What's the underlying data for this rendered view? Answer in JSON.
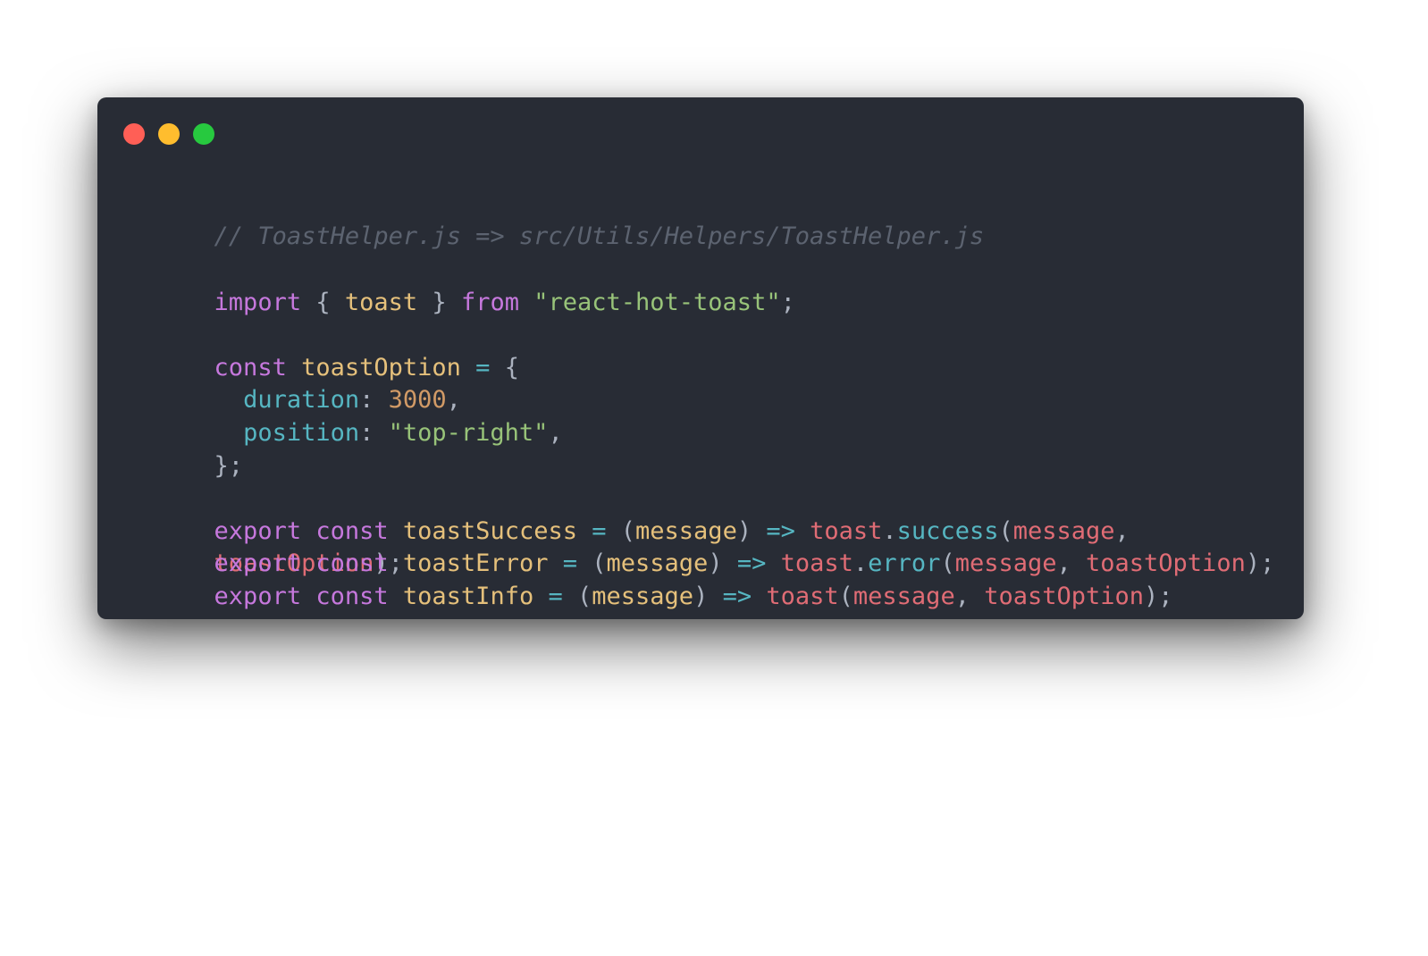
{
  "window": {
    "traffic_lights": [
      {
        "name": "close",
        "color": "#ff5f56"
      },
      {
        "name": "minimize",
        "color": "#ffbd2e"
      },
      {
        "name": "maximize",
        "color": "#27c93f"
      }
    ]
  },
  "code": {
    "comment": "// ToastHelper.js => src/Utils/Helpers/ToastHelper.js",
    "import_line": {
      "kw_import": "import",
      "open_brace": " { ",
      "ident": "toast",
      "close_brace": " } ",
      "kw_from": "from",
      "space": " ",
      "module": "\"react-hot-toast\"",
      "semi": ";"
    },
    "const_line": {
      "kw_const": "const",
      "space": " ",
      "ident": "toastOption",
      "eq": " = ",
      "open": "{"
    },
    "duration_line": {
      "indent": "  ",
      "prop": "duration",
      "colon": ": ",
      "value": "3000",
      "comma": ","
    },
    "position_line": {
      "indent": "  ",
      "prop": "position",
      "colon": ": ",
      "value": "\"top-right\"",
      "comma": ","
    },
    "close_line": "};",
    "success_line": {
      "kw_export": "export",
      "sp1": " ",
      "kw_const": "const",
      "sp2": " ",
      "name": "toastSuccess",
      "eq": " = ",
      "paren_open": "(",
      "param": "message",
      "paren_close": ")",
      "arrow": " => ",
      "obj": "toast",
      "dot": ".",
      "method": "success",
      "call_open": "(",
      "arg": "message",
      "comma": ","
    },
    "success_wrap": {
      "arg": "toastOption",
      "close": ");"
    },
    "error_line": {
      "kw_export": "export",
      "sp1": " ",
      "kw_const": "const",
      "sp2": " ",
      "name": "toastError",
      "eq": " = ",
      "paren_open": "(",
      "param": "message",
      "paren_close": ")",
      "arrow": " => ",
      "obj": "toast",
      "dot": ".",
      "method": "error",
      "call_open": "(",
      "arg1": "message",
      "comma": ", ",
      "arg2": "toastOption",
      "close": ");"
    },
    "info_line": {
      "kw_export": "export",
      "sp1": " ",
      "kw_const": "const",
      "sp2": " ",
      "name": "toastInfo",
      "eq": " = ",
      "paren_open": "(",
      "param": "message",
      "paren_close": ")",
      "arrow": " => ",
      "fn": "toast",
      "call_open": "(",
      "arg1": "message",
      "comma": ", ",
      "arg2": "toastOption",
      "close": ");"
    }
  }
}
